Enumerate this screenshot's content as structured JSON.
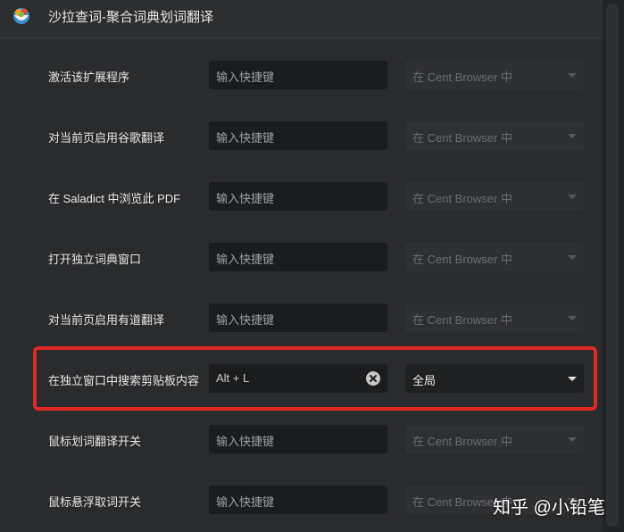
{
  "header": {
    "title": "沙拉查词-聚合词典划词翻译",
    "logo_icon": "saladict-logo-icon"
  },
  "placeholder": "输入快捷键",
  "scope_default": "在 Cent Browser 中",
  "rows": [
    {
      "label": "激活该扩展程序",
      "value": "",
      "scope": "在 Cent Browser 中"
    },
    {
      "label": "对当前页启用谷歌翻译",
      "value": "",
      "scope": "在 Cent Browser 中"
    },
    {
      "label": "在 Saladict 中浏览此 PDF",
      "value": "",
      "scope": "在 Cent Browser 中"
    },
    {
      "label": "打开独立词典窗口",
      "value": "",
      "scope": "在 Cent Browser 中"
    },
    {
      "label": "对当前页启用有道翻译",
      "value": "",
      "scope": "在 Cent Browser 中"
    },
    {
      "label": "在独立窗口中搜索剪贴板内容",
      "value": "Alt + L",
      "scope": "全局"
    },
    {
      "label": "鼠标划词翻译开关",
      "value": "",
      "scope": "在 Cent Browser 中"
    },
    {
      "label": "鼠标悬浮取词开关",
      "value": "",
      "scope": "在 Cent Browser 中"
    }
  ],
  "watermark": "知乎 @小铅笔",
  "colors": {
    "highlight": "#e0282a",
    "background": "#2a2b2d",
    "input_bg": "#1b1c1e"
  }
}
